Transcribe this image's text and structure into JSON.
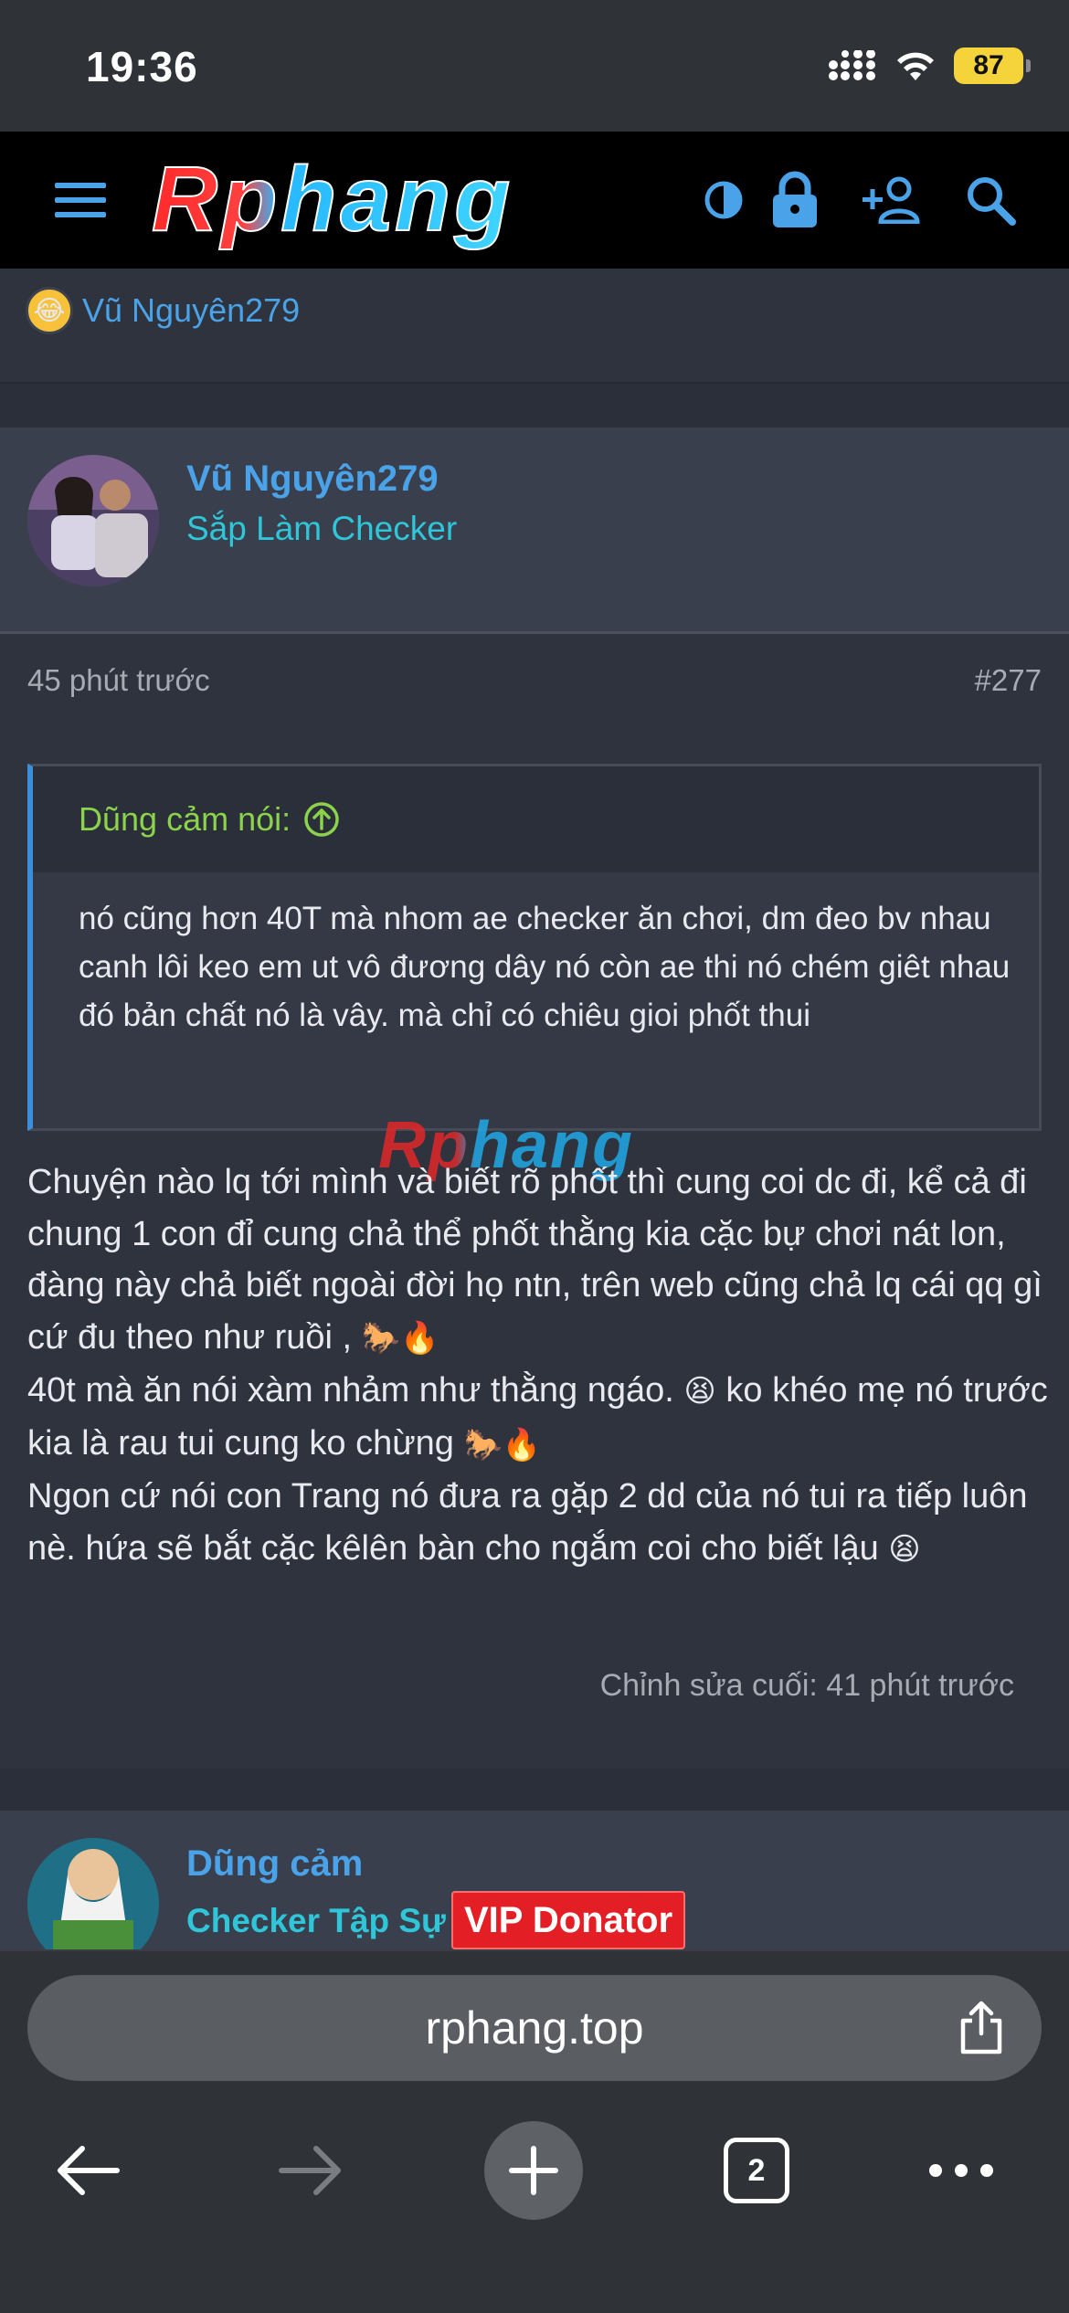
{
  "status_bar": {
    "time": "19:36",
    "battery": "87"
  },
  "header": {
    "logo_text": "Rphang",
    "icons": [
      "menu-icon",
      "theme-toggle-icon",
      "lock-icon",
      "add-user-icon",
      "search-icon"
    ]
  },
  "previous_post": {
    "reaction_user": "Vũ Nguyên279"
  },
  "post": {
    "username": "Vũ Nguyên279",
    "user_title": "Sắp Làm Checker",
    "time": "45 phút trước",
    "number": "#277",
    "quote": {
      "author": "Dũng cảm nói:",
      "text": "nó cũng hơn 40T mà nhom ae checker ăn chơi, dm đeo bv nhau canh lôi keo em ut vô đương dây nó còn ae thi nó chém giêt nhau đó bản chất nó là vây. mà chỉ có chiêu gioi phốt thui"
    },
    "body": {
      "p1": "Chuyện nào lq tới mình và biết rõ phốt thì cung coi dc đi, kể cả đi chung 1 con đỉ cung chả thể phốt thằng kia cặc bự chơi nát lon, đàng này chả biết ngoài đời họ ntn, trên web cũng chả lq cái qq gì cứ đu theo như ruồi ,",
      "p2": "40t mà ăn nói xàm nhảm như thằng ngáo.",
      "p2b": "ko khéo mẹ nó trước kia là rau tui cung ko chừng",
      "p3": "Ngon cứ nói con Trang nó đưa ra gặp 2 dd của nó tui ra tiếp luôn nè. hứa sẽ bắt cặc kêlên bàn cho ngắm coi cho biết lậu"
    },
    "edited": "Chỉnh sửa cuối: 41 phút trước",
    "watermark": "Rphang"
  },
  "next_post": {
    "username": "Dũng cảm",
    "user_title": "Checker Tập Sự",
    "badge": "VIP Donator"
  },
  "browser": {
    "url": "rphang.top",
    "tabs_count": "2"
  },
  "colors": {
    "link_blue": "#4aa3e8",
    "title_cyan": "#2ec6d8",
    "quote_green": "#8bd34a",
    "vip_red": "#e31e24",
    "battery_yellow": "#f4d33b"
  }
}
